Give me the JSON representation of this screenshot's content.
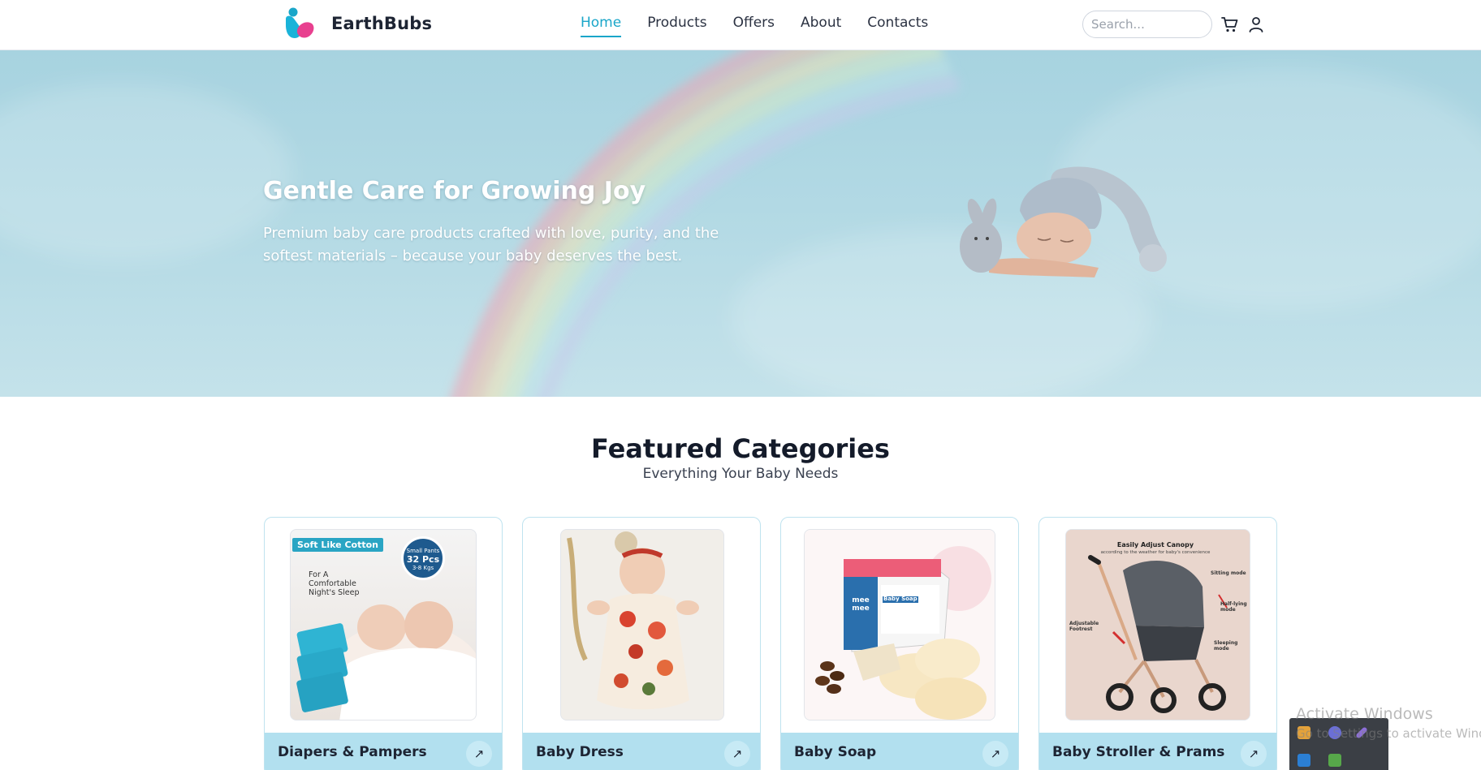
{
  "brand": {
    "name": "EarthBubs",
    "logo_icon": "heart-drop-logo-icon",
    "colors": {
      "primary": "#1aa6c9",
      "secondary": "#e8408f"
    }
  },
  "nav": {
    "items": [
      {
        "label": "Home",
        "active": true
      },
      {
        "label": "Products",
        "active": false
      },
      {
        "label": "Offers",
        "active": false
      },
      {
        "label": "About",
        "active": false
      },
      {
        "label": "Contacts",
        "active": false
      }
    ]
  },
  "search": {
    "placeholder": "Search...",
    "value": ""
  },
  "header_icons": {
    "cart": "cart-icon",
    "account": "user-icon"
  },
  "hero": {
    "title": "Gentle Care for Growing Joy",
    "subtitle": "Premium baby care products crafted with love, purity, and the softest materials – because your baby deserves the best."
  },
  "featured": {
    "title": "Featured Categories",
    "subtitle": "Everything Your Baby Needs",
    "categories": [
      {
        "label": "Diapers & Pampers",
        "image_text": {
          "badge": "Soft Like Cotton",
          "caption": "For A Comfortable Night's Sleep",
          "seal_top": "Small Pants",
          "seal_count": "32 Pcs",
          "seal_weight": "3-8 Kgs"
        }
      },
      {
        "label": "Baby Dress"
      },
      {
        "label": "Baby Soap",
        "image_text": {
          "brand": "mee mee",
          "product": "Baby Soap"
        }
      },
      {
        "label": "Baby Stroller & Prams",
        "image_text": {
          "canopy": "Easily Adjust Canopy",
          "canopy_sub": "according to the weather for baby's convenience",
          "mode1": "Sitting mode",
          "mode2": "Half-lying mode",
          "mode3": "Sleeping mode",
          "footrest": "Adjustable Footrest"
        }
      }
    ]
  },
  "os_overlay": {
    "title": "Activate Windows",
    "subtitle": "Go to Settings to activate Windows."
  }
}
